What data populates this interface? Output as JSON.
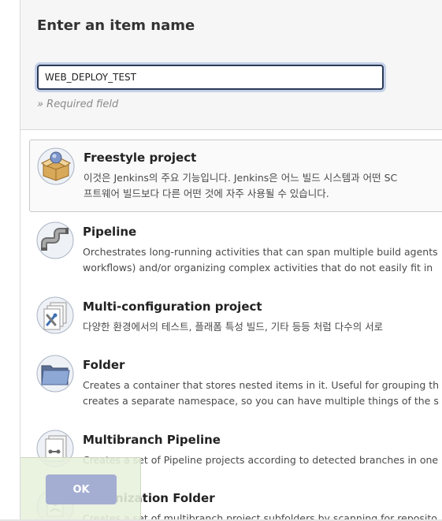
{
  "header": {
    "title": "Enter an item name",
    "item_name_value": "WEB_DEPLOY_TEST",
    "required_hint": "» Required field"
  },
  "items": [
    {
      "title": "Freestyle project",
      "icon": "freestyle-project-icon",
      "selected": true,
      "desc": [
        "이것은 Jenkins의 주요 기능입니다. Jenkins은 어느 빌드 시스템과 어떤 SC",
        "프트웨어 빌드보다 다른 어떤 것에 자주 사용될 수 있습니다."
      ]
    },
    {
      "title": "Pipeline",
      "icon": "pipeline-icon",
      "selected": false,
      "desc": [
        "Orchestrates long-running activities that can span multiple build agents",
        "workflows) and/or organizing complex activities that do not easily fit in"
      ]
    },
    {
      "title": "Multi-configuration project",
      "icon": "multi-configuration-project-icon",
      "selected": false,
      "desc": [
        "다양한 환경에서의 테스트, 플래폼 특성 빌드, 기타 등등 처럼 다수의 서로"
      ]
    },
    {
      "title": "Folder",
      "icon": "folder-icon",
      "selected": false,
      "desc": [
        "Creates a container that stores nested items in it. Useful for grouping th",
        "creates a separate namespace, so you can have multiple things of the s"
      ]
    },
    {
      "title": "Multibranch Pipeline",
      "icon": "multibranch-pipeline-icon",
      "selected": false,
      "desc": [
        "Creates a set of Pipeline projects according to detected branches in one"
      ]
    },
    {
      "title": "Organization Folder",
      "icon": "organization-folder-icon",
      "selected": false,
      "desc": [
        "Creates a set of multibranch project subfolders by scanning for reposito"
      ]
    }
  ],
  "footer": {
    "ok_label": "OK"
  },
  "colors": {
    "header_bg": "#f6f6f6",
    "input_border": "#2a3a57",
    "ok_button": "#a4aed2",
    "ok_panel": "#e7f0dc"
  }
}
